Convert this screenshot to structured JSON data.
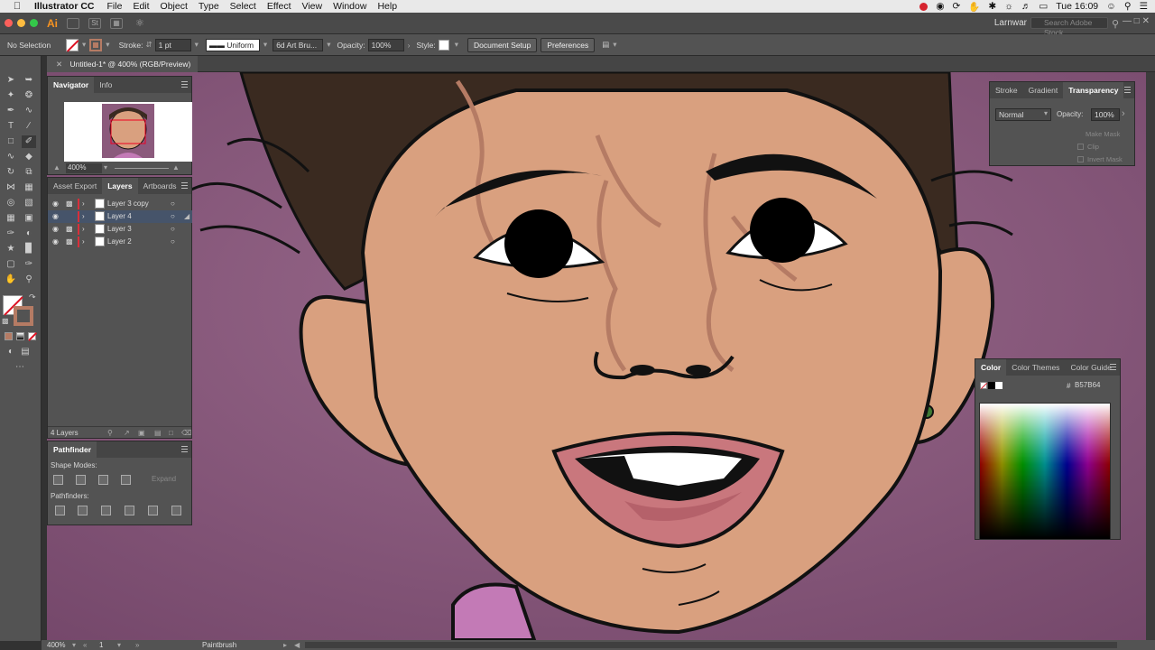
{
  "menubar": {
    "app_name": "Illustrator CC",
    "items": [
      "File",
      "Edit",
      "Object",
      "Type",
      "Select",
      "Effect",
      "View",
      "Window",
      "Help"
    ],
    "clock": "Tue 16:09"
  },
  "appbar": {
    "logo": "Ai",
    "st_label": "St",
    "user": "Larnwar",
    "search_placeholder": "Search Adobe Stock"
  },
  "options_bar": {
    "selection": "No Selection",
    "stroke_label": "Stroke:",
    "stroke_value": "1 pt",
    "profile": "Uniform",
    "brush": "6d Art Bru...",
    "opacity_label": "Opacity:",
    "opacity_value": "100%",
    "style_label": "Style:",
    "document_setup": "Document Setup",
    "preferences": "Preferences"
  },
  "document": {
    "tab_title": "Untitled-1* @ 400% (RGB/Preview)"
  },
  "navigator": {
    "tabs": [
      "Navigator",
      "Info"
    ],
    "zoom": "400%"
  },
  "layers": {
    "tabs": [
      "Asset Export",
      "Layers",
      "Artboards"
    ],
    "rows": [
      {
        "name": "Layer 3 copy",
        "locked": true,
        "selected": false,
        "color": "#d92f3a"
      },
      {
        "name": "Layer 4",
        "locked": false,
        "selected": true,
        "color": "#d92f3a"
      },
      {
        "name": "Layer 3",
        "locked": true,
        "selected": false,
        "color": "#d92f3a"
      },
      {
        "name": "Layer 2",
        "locked": true,
        "selected": false,
        "color": "#d92f3a"
      }
    ],
    "count": "4 Layers"
  },
  "pathfinder": {
    "title": "Pathfinder",
    "shape_modes": "Shape Modes:",
    "expand": "Expand",
    "pathfinders": "Pathfinders:"
  },
  "transparency": {
    "tabs": [
      "Stroke",
      "Gradient",
      "Transparency"
    ],
    "blend_mode": "Normal",
    "opacity_label": "Opacity:",
    "opacity_value": "100%",
    "make_mask": "Make Mask",
    "clip": "Clip",
    "invert_mask": "Invert Mask"
  },
  "color_panel": {
    "tabs": [
      "Color",
      "Color Themes",
      "Color Guide"
    ],
    "hex_prefix": "#",
    "hex": "B57B64"
  },
  "status": {
    "zoom": "400%",
    "artboard": "1",
    "tool": "Paintbrush"
  },
  "colors": {
    "skin": "#d9a07f",
    "bg": "#8b5a7c",
    "hair": "#3a2a20",
    "lip": "#c9777d",
    "shadow": "#b57b64"
  }
}
